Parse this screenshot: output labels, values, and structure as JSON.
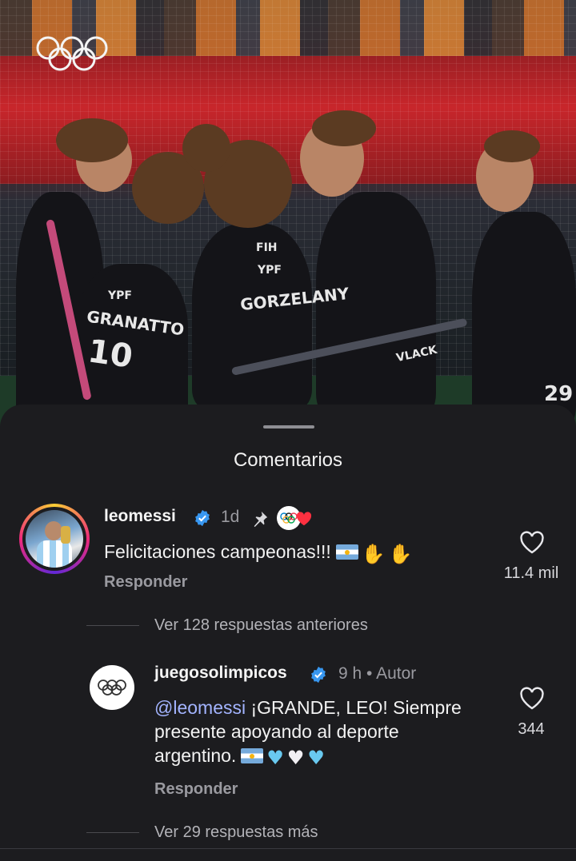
{
  "sheet": {
    "title": "Comentarios"
  },
  "comments": [
    {
      "username": "leomessi",
      "time": "1d",
      "text": "Felicitaciones campeonas!!!",
      "reply_label": "Responder",
      "likes": "11.4 mil",
      "icons": [
        "verified-badge",
        "pin-icon",
        "olympic-avatar-liked",
        "red-heart"
      ],
      "emoji": [
        "flag-argentina",
        "clapping-hands",
        "clapping-hands"
      ]
    },
    {
      "username": "juegosolimpicos",
      "time": "9 h",
      "author_tag": "Autor",
      "mention": "@leomessi",
      "text": "¡GRANDE, LEO! Siempre presente apoyando al deporte argentino.",
      "reply_label": "Responder",
      "likes": "344",
      "emoji": [
        "flag-argentina",
        "light-blue-heart",
        "white-heart",
        "light-blue-heart"
      ]
    }
  ],
  "threads": {
    "previous": "Ver 128 respuestas anteriores",
    "more": "Ver 29 respuestas más"
  },
  "colors": {
    "background": "#1c1c1f",
    "verified": "#3897f0",
    "mention": "#a3b4ff",
    "muted": "#9a9aa0"
  }
}
